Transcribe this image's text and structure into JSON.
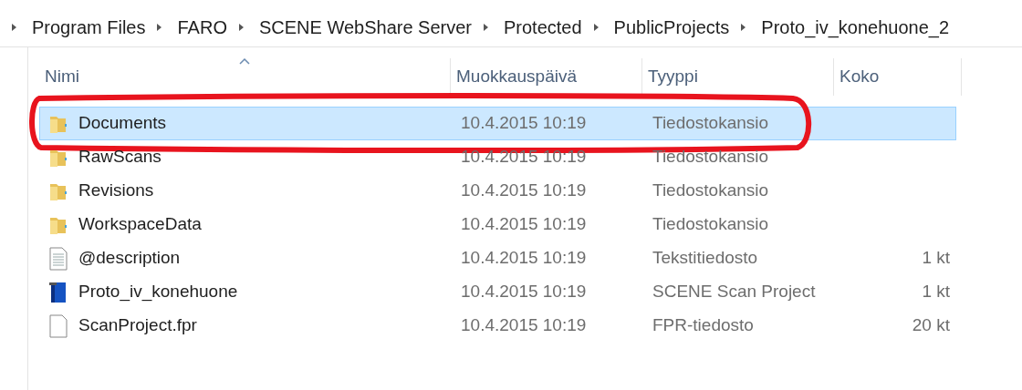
{
  "breadcrumb": [
    "Program Files",
    "FARO",
    "SCENE WebShare Server",
    "Protected",
    "PublicProjects",
    "Proto_iv_konehuone_2"
  ],
  "columns": [
    {
      "label": "Nimi",
      "sorted": true
    },
    {
      "label": "Muokkauspäivä",
      "sorted": false
    },
    {
      "label": "Tyyppi",
      "sorted": false
    },
    {
      "label": "Koko",
      "sorted": false
    }
  ],
  "rows": [
    {
      "kind": "folder",
      "name": "Documents",
      "modified": "10.4.2015 10:19",
      "type": "Tiedostokansio",
      "selected": true,
      "highlighted": true
    },
    {
      "kind": "folder",
      "name": "RawScans",
      "modified": "10.4.2015 10:19",
      "type": "Tiedostokansio",
      "selected": false,
      "highlighted": false
    },
    {
      "kind": "folder",
      "name": "Revisions",
      "modified": "10.4.2015 10:19",
      "type": "Tiedostokansio",
      "selected": false,
      "highlighted": false
    },
    {
      "kind": "folder",
      "name": "WorkspaceData",
      "modified": "10.4.2015 10:19",
      "type": "Tiedostokansio",
      "selected": false,
      "highlighted": false
    },
    {
      "kind": "text",
      "name": "@description",
      "modified": "10.4.2015 10:19",
      "type": "Tekstitiedosto",
      "size": "1 kt",
      "selected": false,
      "highlighted": false
    },
    {
      "kind": "project",
      "name": "Proto_iv_konehuone",
      "modified": "10.4.2015 10:19",
      "type": "SCENE Scan Project",
      "size": "1 kt",
      "selected": false,
      "highlighted": false
    },
    {
      "kind": "file",
      "name": "ScanProject.fpr",
      "modified": "10.4.2015 10:19",
      "type": "FPR-tiedosto",
      "size": "20 kt",
      "selected": false,
      "highlighted": false
    }
  ]
}
